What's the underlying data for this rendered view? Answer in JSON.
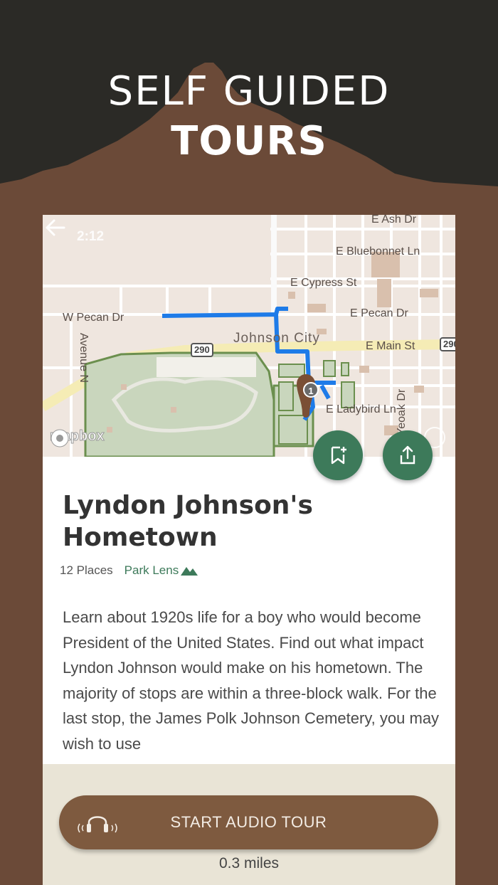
{
  "hero": {
    "line1": "SELF GUIDED",
    "line2": "TOURS"
  },
  "colors": {
    "hero_dark": "#2b2a26",
    "mountain": "#6b4a38",
    "accent_green": "#3d7a5a",
    "route_blue": "#1e7be8",
    "button_brown": "#7e5a3f",
    "panel_bg": "#e9e4d6"
  },
  "map": {
    "status_time": "2:12",
    "streets": {
      "ash": "E Ash Dr",
      "bluebonnet": "E Bluebonnet Ln",
      "cypress": "E Cypress St",
      "w_pecan": "W Pecan Dr",
      "e_pecan": "E Pecan Dr",
      "main": "E Main St",
      "avenue_n": "Avenue N",
      "ladybird": "E Ladybird Ln",
      "yeoak": "Yeoak Dr"
    },
    "city": "Johnson City",
    "highway_1": "290",
    "highway_2": "290",
    "marker_number": "1",
    "attribution": "mapbox"
  },
  "tour": {
    "title": "Lyndon Johnson's Hometown",
    "places": "12 Places",
    "source": "Park Lens",
    "description": "Learn about 1920s life for a boy who would become President of the United States. Find out what impact Lyndon Johnson would make on his hometown. The majority of stops are within a three-block walk. For the last stop, the James Polk Johnson Cemetery, you may wish to use"
  },
  "actions": {
    "start_label": "START AUDIO TOUR",
    "distance": "0.3 miles"
  },
  "icons": {
    "back": "back-arrow-icon",
    "bookmark": "bookmark-add-icon",
    "share": "share-icon",
    "headphones": "headphones-icon",
    "mountain": "mountain-icon",
    "info": "info-icon"
  }
}
